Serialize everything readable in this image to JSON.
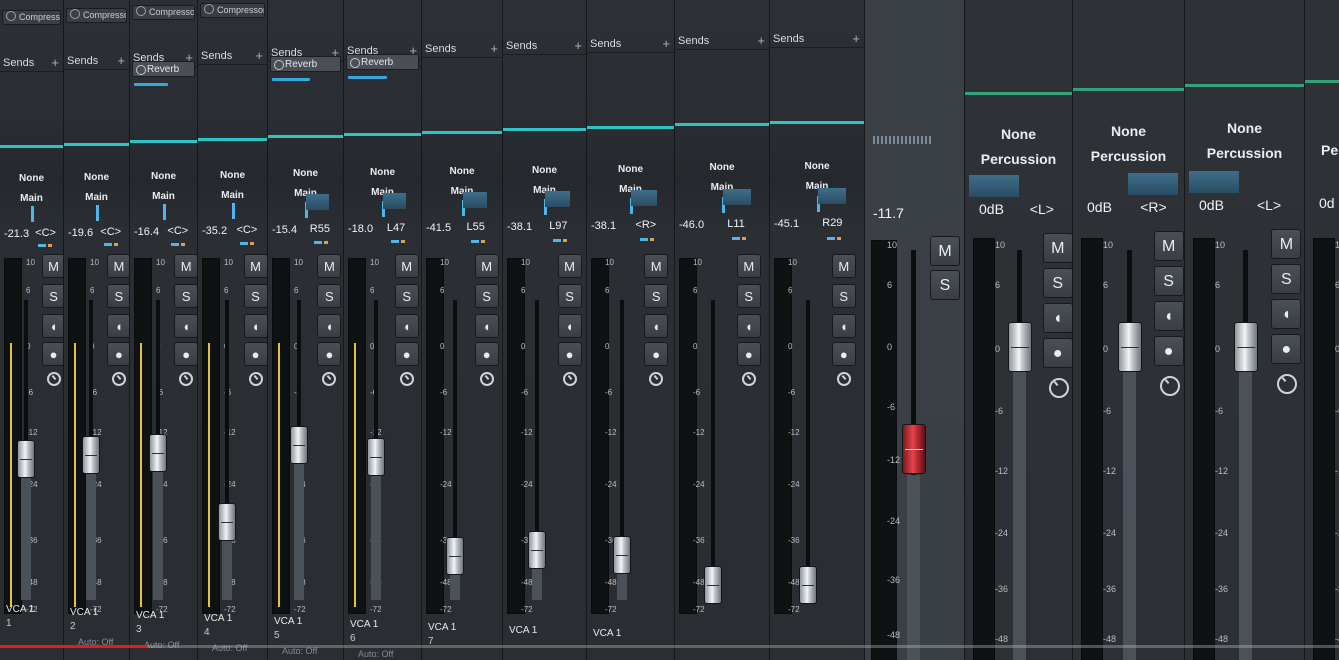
{
  "common": {
    "sends": "Sends",
    "plus": "+",
    "none": "None",
    "main": "Main",
    "mute": "M",
    "solo": "S",
    "auto_off": "Auto: Off"
  },
  "channels": [
    {
      "insert": "Compressor",
      "send": null,
      "vol": "-21.3",
      "pan": "<C>",
      "vca": "VCA 1",
      "num": "1"
    },
    {
      "insert": "Compressor",
      "send": null,
      "vol": "-19.6",
      "pan": "<C>",
      "vca": "VCA 1",
      "num": "2"
    },
    {
      "insert": "Compressor",
      "send": "Reverb",
      "vol": "-16.4",
      "pan": "<C>",
      "vca": "VCA 1",
      "num": "3"
    },
    {
      "insert": "Compressor",
      "send": null,
      "vol": "-35.2",
      "pan": "<C>",
      "vca": "VCA 1",
      "num": "4"
    },
    {
      "insert": "",
      "send": "Reverb",
      "vol": "-15.4",
      "pan": "R55",
      "vca": "VCA 1",
      "num": "5"
    },
    {
      "insert": "",
      "send": "Reverb",
      "vol": "-18.0",
      "pan": "L47",
      "vca": "VCA 1",
      "num": "6"
    },
    {
      "insert": "",
      "send": null,
      "vol": "-41.5",
      "pan": "L55",
      "vca": "VCA 1",
      "num": "7"
    },
    {
      "insert": "",
      "send": null,
      "vol": "-38.1",
      "pan": "L97",
      "vca": "VCA 1",
      "num": ""
    },
    {
      "insert": "",
      "send": null,
      "vol": "-38.1",
      "pan": "<R>",
      "vca": "VCA 1",
      "num": ""
    },
    {
      "insert": "",
      "send": null,
      "vol": "-46.0",
      "pan": "L11",
      "vca": "",
      "num": ""
    },
    {
      "insert": "",
      "send": null,
      "vol": "-45.1",
      "pan": "R29",
      "vca": "",
      "num": ""
    }
  ],
  "vca_channel": {
    "vol": "-11.7",
    "mute": "M",
    "solo": "S"
  },
  "bus_channels": [
    {
      "label": "None",
      "output": "Percussion",
      "vol": "0dB",
      "pan": "<L>"
    },
    {
      "label": "None",
      "output": "Percussion",
      "vol": "0dB",
      "pan": "<R>"
    },
    {
      "label": "None",
      "output": "Percussion",
      "vol": "0dB",
      "pan": "<L>"
    },
    {
      "label": "",
      "output": "Pe",
      "vol": "0d",
      "pan": ""
    }
  ],
  "scale_small": [
    "10",
    "6",
    "0",
    "-6",
    "-12",
    "-24",
    "-36",
    "-48",
    "-72"
  ],
  "scale_big": [
    "10",
    "6",
    "0",
    "-6",
    "-12",
    "-24",
    "-36",
    "-48",
    "-72"
  ],
  "video_progress": 0.11,
  "colors": {
    "accent_teal": "#2ec4c6",
    "accent_green": "#2da67d",
    "meter_yellow": "#e5c23a",
    "fader_red": "#e8434c"
  }
}
